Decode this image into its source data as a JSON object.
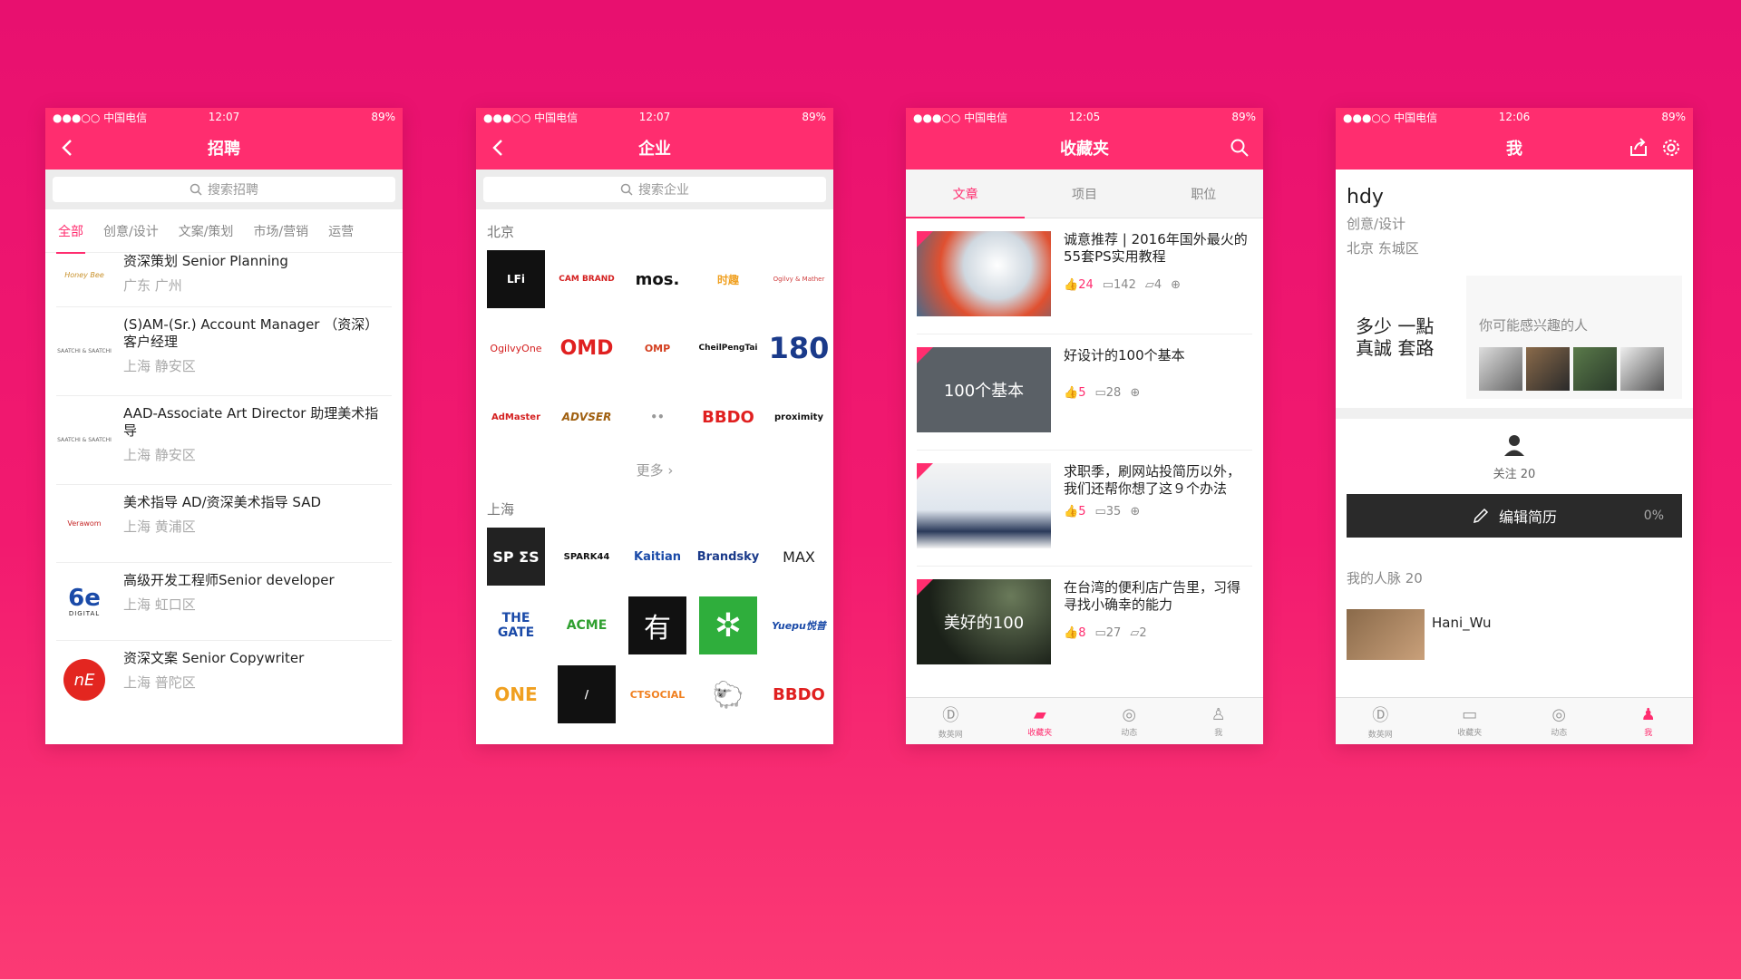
{
  "status": {
    "carrier": "●●●○○ 中国电信",
    "battery": "89%"
  },
  "phone1": {
    "time": "12:07",
    "title": "招聘",
    "search_placeholder": "搜索招聘",
    "filters": [
      "全部",
      "创意/设计",
      "文案/策划",
      "市场/营销",
      "运营"
    ],
    "jobs": [
      {
        "logo": "Honey Bee",
        "title": "资深策划 Senior Planning",
        "location": "广东 广州"
      },
      {
        "logo": "SAATCHI & SAATCHI",
        "title": "(S)AM-(Sr.) Account Manager （资深）客户经理",
        "location": "上海 静安区"
      },
      {
        "logo": "SAATCHI & SAATCHI",
        "title": "AAD-Associate Art Director 助理美术指导",
        "location": "上海 静安区"
      },
      {
        "logo": "Verawom",
        "title": "美术指导 AD/资深美术指导 SAD",
        "location": "上海 黄浦区"
      },
      {
        "logo": "DIGITAL",
        "title": "高级开发工程师Senior developer",
        "location": "上海 虹口区"
      },
      {
        "logo": "nE",
        "title": "资深文案 Senior Copywriter",
        "location": "上海 普陀区"
      }
    ]
  },
  "phone2": {
    "time": "12:07",
    "title": "企业",
    "search_placeholder": "搜索企业",
    "city1": "北京",
    "city1_logos": [
      "LFi",
      "CAM BRAND",
      "mos.",
      "时趣",
      "Ogilvy & Mather",
      "OgilvyOne",
      "OMD",
      "OMP",
      "CheilPengTai",
      "180",
      "AdMaster",
      "ADVSER",
      "••",
      "BBDO",
      "proximity"
    ],
    "more": "更多 ›",
    "city2": "上海",
    "city2_logos": [
      "SP ΣS",
      "SPARK44",
      "Kaitian",
      "Brandsky",
      "MAX",
      "THE GATE",
      "ACME",
      "有",
      "✲",
      "Yuepu悦普",
      "ONE",
      "/",
      "CTSOCIAL",
      "🐑",
      "BBDO"
    ]
  },
  "phone3": {
    "time": "12:05",
    "title": "收藏夹",
    "tabs": [
      "文章",
      "项目",
      "职位"
    ],
    "articles": [
      {
        "title": "诚意推荐 | 2016年国外最火的55套PS实用教程",
        "likes": "24",
        "comments": "142",
        "replies": "4",
        "thumb": ""
      },
      {
        "title": "好设计的100个基本",
        "likes": "5",
        "comments": "28",
        "replies": "",
        "thumb": "100个基本"
      },
      {
        "title": "求职季，刷网站投简历以外，我们还帮你想了这９个办法",
        "likes": "5",
        "comments": "35",
        "replies": "",
        "thumb": ""
      },
      {
        "title": "在台湾的便利店广告里，习得寻找小确幸的能力",
        "likes": "8",
        "comments": "27",
        "replies": "2",
        "thumb": "美好的100"
      }
    ],
    "tabbar": [
      "数英网",
      "收藏夹",
      "动态",
      "我"
    ]
  },
  "phone4": {
    "time": "12:06",
    "title": "我",
    "name": "hdy",
    "role": "创意/设计",
    "location": "北京 东城区",
    "calligraphy": "多少 一點 真誠 套路",
    "suggest_label": "你可能感兴趣的人",
    "follow": "关注 20",
    "edit_label": "编辑简历",
    "edit_pct": "0%",
    "network": "我的人脉  20",
    "contact_name": "Hani_Wu",
    "tabbar": [
      "数英网",
      "收藏夹",
      "动态",
      "我"
    ]
  },
  "colors": {
    "brand": "#ff2d6f",
    "background": "#ef1470"
  }
}
